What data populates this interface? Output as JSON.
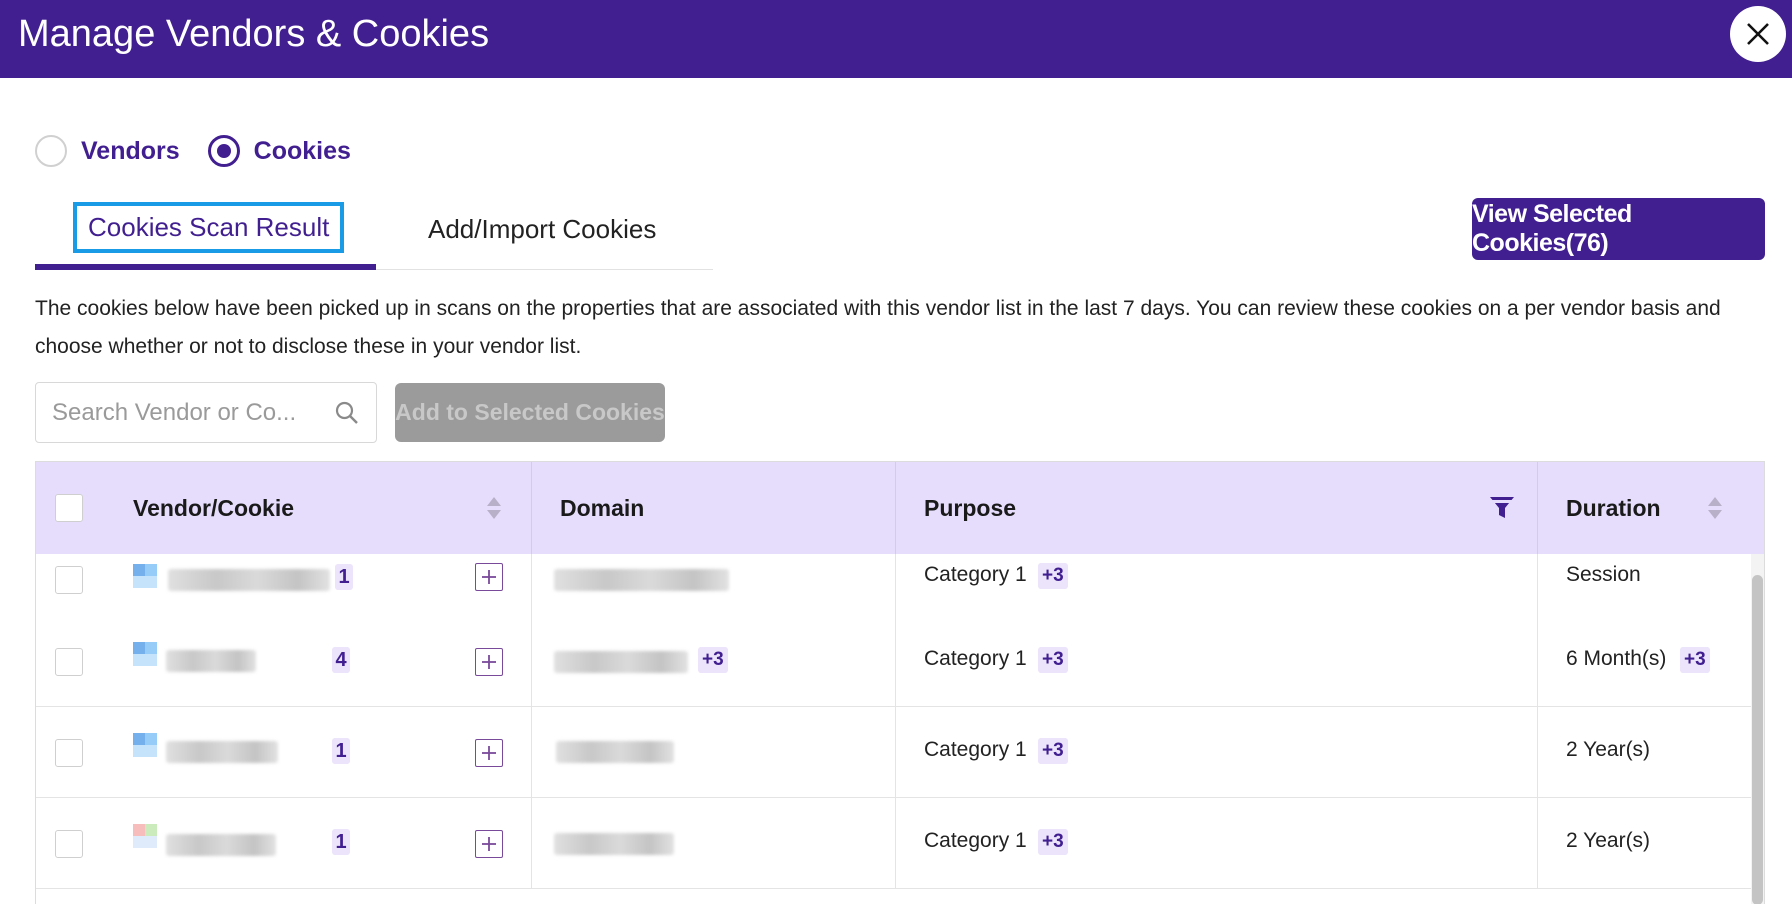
{
  "header": {
    "title": "Manage Vendors & Cookies",
    "close_icon": "close-icon"
  },
  "mode": {
    "options": [
      {
        "label": "Vendors",
        "selected": false
      },
      {
        "label": "Cookies",
        "selected": true
      }
    ]
  },
  "tabs": [
    {
      "label": "Cookies Scan Result",
      "active": true
    },
    {
      "label": "Add/Import Cookies",
      "active": false
    }
  ],
  "view_selected_label": "View Selected Cookies(76)",
  "description": "The cookies below have been picked up in scans on the properties that are associated with this vendor list in the last 7 days. You can review these cookies on a per vendor basis and choose whether or not to disclose these in your vendor list.",
  "search": {
    "placeholder": "Search Vendor or Co...",
    "value": ""
  },
  "add_selected_label": "Add to Selected Cookies",
  "table": {
    "columns": [
      {
        "label": "Vendor/Cookie",
        "control": "sort"
      },
      {
        "label": "Domain",
        "control": "none"
      },
      {
        "label": "Purpose",
        "control": "filter"
      },
      {
        "label": "Duration",
        "control": "sort"
      }
    ],
    "rows": [
      {
        "count": "1",
        "domain_extra": "",
        "purpose": "Category 1",
        "purpose_extra": "+3",
        "duration": "Session",
        "duration_extra": ""
      },
      {
        "count": "4",
        "domain_extra": "+3",
        "purpose": "Category 1",
        "purpose_extra": "+3",
        "duration": "6 Month(s)",
        "duration_extra": "+3"
      },
      {
        "count": "1",
        "domain_extra": "",
        "purpose": "Category 1",
        "purpose_extra": "+3",
        "duration": "2 Year(s)",
        "duration_extra": ""
      },
      {
        "count": "1",
        "domain_extra": "",
        "purpose": "Category 1",
        "purpose_extra": "+3",
        "duration": "2 Year(s)",
        "duration_extra": ""
      }
    ]
  },
  "colors": {
    "brand": "#411f90",
    "header_bg": "#e6ddfc",
    "focus_outline": "#1a9be6",
    "disabled_button": "#9b9b9b"
  }
}
